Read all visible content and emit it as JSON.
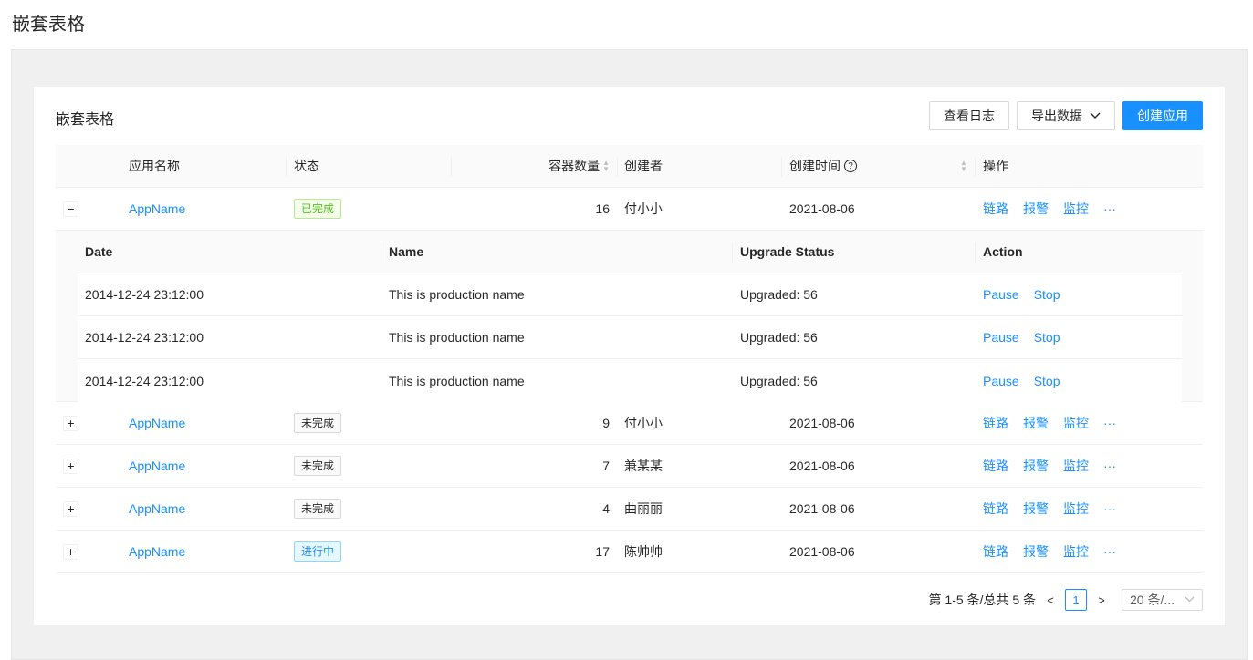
{
  "page_title": "嵌套表格",
  "card": {
    "title": "嵌套表格",
    "buttons": {
      "logs": "查看日志",
      "export": "导出数据",
      "create": "创建应用"
    }
  },
  "columns": {
    "name": "应用名称",
    "status": "状态",
    "containers": "容器数量",
    "creator": "创建者",
    "created_at": "创建时间",
    "actions": "操作"
  },
  "row_actions": {
    "link": "链路",
    "alert": "报警",
    "monitor": "监控",
    "more": "···"
  },
  "rows": [
    {
      "expanded": true,
      "name": "AppName",
      "status": "已完成",
      "status_type": "done",
      "containers": "16",
      "creator": "付小小",
      "created_at": "2021-08-06"
    },
    {
      "expanded": false,
      "name": "AppName",
      "status": "未完成",
      "status_type": "undone",
      "containers": "9",
      "creator": "付小小",
      "created_at": "2021-08-06"
    },
    {
      "expanded": false,
      "name": "AppName",
      "status": "未完成",
      "status_type": "undone",
      "containers": "7",
      "creator": "兼某某",
      "created_at": "2021-08-06"
    },
    {
      "expanded": false,
      "name": "AppName",
      "status": "未完成",
      "status_type": "undone",
      "containers": "4",
      "creator": "曲丽丽",
      "created_at": "2021-08-06"
    },
    {
      "expanded": false,
      "name": "AppName",
      "status": "进行中",
      "status_type": "doing",
      "containers": "17",
      "creator": "陈帅帅",
      "created_at": "2021-08-06"
    }
  ],
  "nested": {
    "columns": {
      "date": "Date",
      "name": "Name",
      "upgrade": "Upgrade Status",
      "action": "Action"
    },
    "actions": {
      "pause": "Pause",
      "stop": "Stop"
    },
    "rows": [
      {
        "date": "2014-12-24 23:12:00",
        "name": "This is production name",
        "upgrade": "Upgraded: 56"
      },
      {
        "date": "2014-12-24 23:12:00",
        "name": "This is production name",
        "upgrade": "Upgraded: 56"
      },
      {
        "date": "2014-12-24 23:12:00",
        "name": "This is production name",
        "upgrade": "Upgraded: 56"
      }
    ]
  },
  "pagination": {
    "summary": "第 1-5 条/总共 5 条",
    "current_page": "1",
    "page_size": "20 条/..."
  },
  "icons": {
    "expand_open": "minus-icon",
    "expand_closed": "plus-icon"
  },
  "colors": {
    "primary": "#1890ff",
    "success": "#52c41a"
  }
}
